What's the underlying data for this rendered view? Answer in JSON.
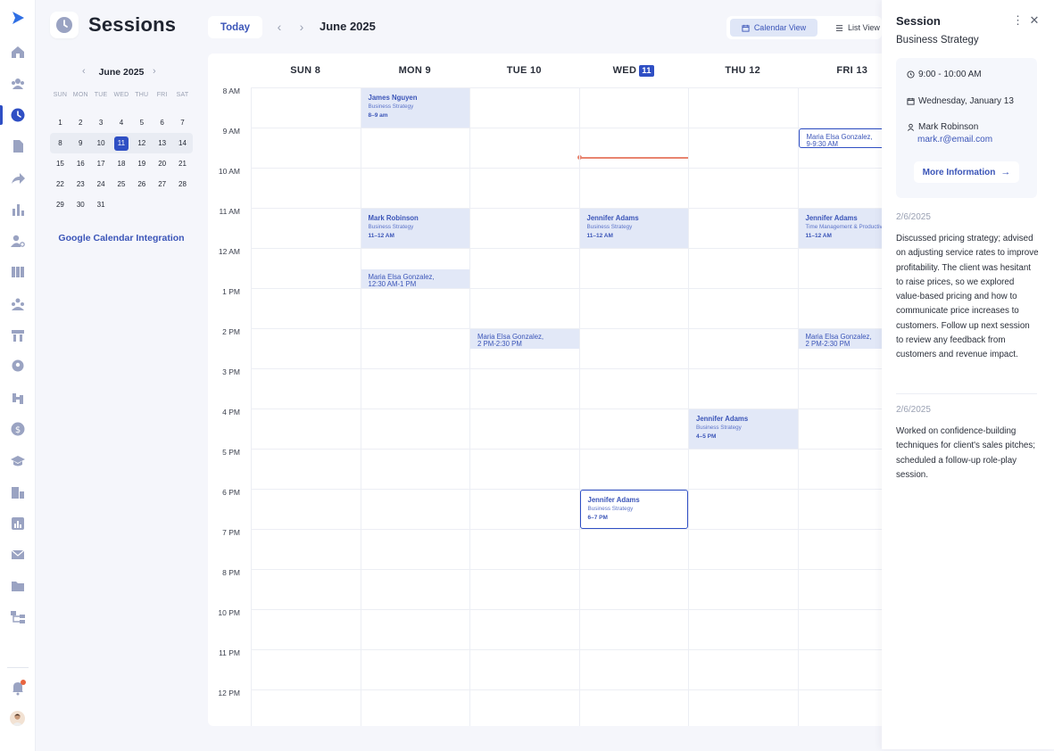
{
  "page": {
    "title": "Sessions"
  },
  "toolbar": {
    "today_label": "Today",
    "period_label": "June 2025",
    "calendar_view_label": "Calendar View",
    "list_view_label": "List View"
  },
  "mini_calendar": {
    "title": "June 2025",
    "weekdays": [
      "SUN",
      "MON",
      "TUE",
      "WED",
      "THU",
      "FRI",
      "SAT"
    ],
    "weeks": [
      [
        "1",
        "2",
        "3",
        "4",
        "5",
        "6",
        "7"
      ],
      [
        "8",
        "9",
        "10",
        "11",
        "12",
        "13",
        "14"
      ],
      [
        "15",
        "16",
        "17",
        "18",
        "19",
        "20",
        "21"
      ],
      [
        "22",
        "23",
        "24",
        "25",
        "26",
        "27",
        "28"
      ],
      [
        "29",
        "30",
        "31",
        "",
        "",
        "",
        ""
      ]
    ],
    "selected_week": 1,
    "today": "11"
  },
  "google_calendar_link": "Google Calendar Integration",
  "week_days": [
    {
      "label": "SUN 8"
    },
    {
      "label": "MON 9"
    },
    {
      "label": "TUE 10"
    },
    {
      "label": "WED",
      "badge": "11"
    },
    {
      "label": "THU 12"
    },
    {
      "label": "FRI 13"
    }
  ],
  "time_labels": [
    "8 AM",
    "9 AM",
    "10 AM",
    "11 AM",
    "12 AM",
    "1 PM",
    "2 PM",
    "3 PM",
    "4 PM",
    "5 PM",
    "6 PM",
    "7 PM",
    "8 PM",
    "10 PM",
    "11 PM",
    "12 PM"
  ],
  "events": [
    {
      "day": 1,
      "start": 0,
      "duration": 1,
      "style": "filled",
      "name": "James Nguyen",
      "type": "Business Strategy",
      "time": "8–9 am"
    },
    {
      "day": 5,
      "start": 1,
      "duration": 0.5,
      "style": "outline",
      "lines": [
        "Maria Elsa Gonzalez,",
        "9-9:30 AM"
      ]
    },
    {
      "day": 1,
      "start": 3,
      "duration": 1,
      "style": "filled",
      "name": "Mark Robinson",
      "type": "Business Strategy",
      "time": "11–12 AM"
    },
    {
      "day": 3,
      "start": 3,
      "duration": 1,
      "style": "filled",
      "name": "Jennifer Adams",
      "type": "Business Strategy",
      "time": "11–12 AM"
    },
    {
      "day": 5,
      "start": 3,
      "duration": 1,
      "style": "filled",
      "name": "Jennifer Adams",
      "type": "Time Management & Productivity",
      "time": "11–12 AM"
    },
    {
      "day": 1,
      "start": 4.5,
      "duration": 0.5,
      "style": "filled",
      "lines": [
        "Maria Elsa Gonzalez,",
        "12:30 AM-1 PM"
      ]
    },
    {
      "day": 2,
      "start": 6,
      "duration": 0.5,
      "style": "filled",
      "lines": [
        "Maria Elsa Gonzalez,",
        "2 PM-2:30 PM"
      ]
    },
    {
      "day": 5,
      "start": 6,
      "duration": 0.5,
      "style": "filled",
      "lines": [
        "Maria Elsa Gonzalez,",
        "2 PM-2:30 PM"
      ]
    },
    {
      "day": 4,
      "start": 8,
      "duration": 1,
      "style": "filled",
      "name": "Jennifer Adams",
      "type": "Business Strategy",
      "time": "4–5 PM"
    },
    {
      "day": 3,
      "start": 10,
      "duration": 1,
      "style": "outline",
      "name": "Jennifer Adams",
      "type": "Business Strategy",
      "time": "6–7 PM"
    }
  ],
  "now_indicator": {
    "day": 3,
    "at": 1.75
  },
  "panel": {
    "title": "Session",
    "subtitle": "Business Strategy",
    "time": "9:00 - 10:00 AM",
    "date": "Wednesday, January 13",
    "client_name": "Mark Robinson",
    "client_email": "mark.r@email.com",
    "more_info_label": "More Information",
    "notes": [
      {
        "date": "2/6/2025",
        "text": "Discussed pricing strategy; advised on adjusting service rates to improve profitability. The client was hesitant to raise prices, so we explored value-based pricing and how to communicate price increases to customers. Follow up next session to review any feedback from customers and revenue impact."
      },
      {
        "date": "2/6/2025",
        "text": "Worked on confidence-building techniques for client's sales pitches; scheduled a follow-up role-play session."
      }
    ]
  },
  "sidebar_icons": [
    "logo-icon",
    "home-icon",
    "clients-icon",
    "sessions-icon",
    "documents-icon",
    "share-icon",
    "reports-icon",
    "user-search-icon",
    "programs-icon",
    "groups-icon",
    "events-icon",
    "profile-icon",
    "tools-icon",
    "billing-icon",
    "education-icon",
    "organization-icon",
    "analytics-icon",
    "mail-icon",
    "folder-icon",
    "workflow-icon",
    "notification-bell-icon"
  ],
  "colors": {
    "accent": "#2f4fc4",
    "event_bg": "#e2e8f7",
    "now_line": "#e8846f"
  }
}
